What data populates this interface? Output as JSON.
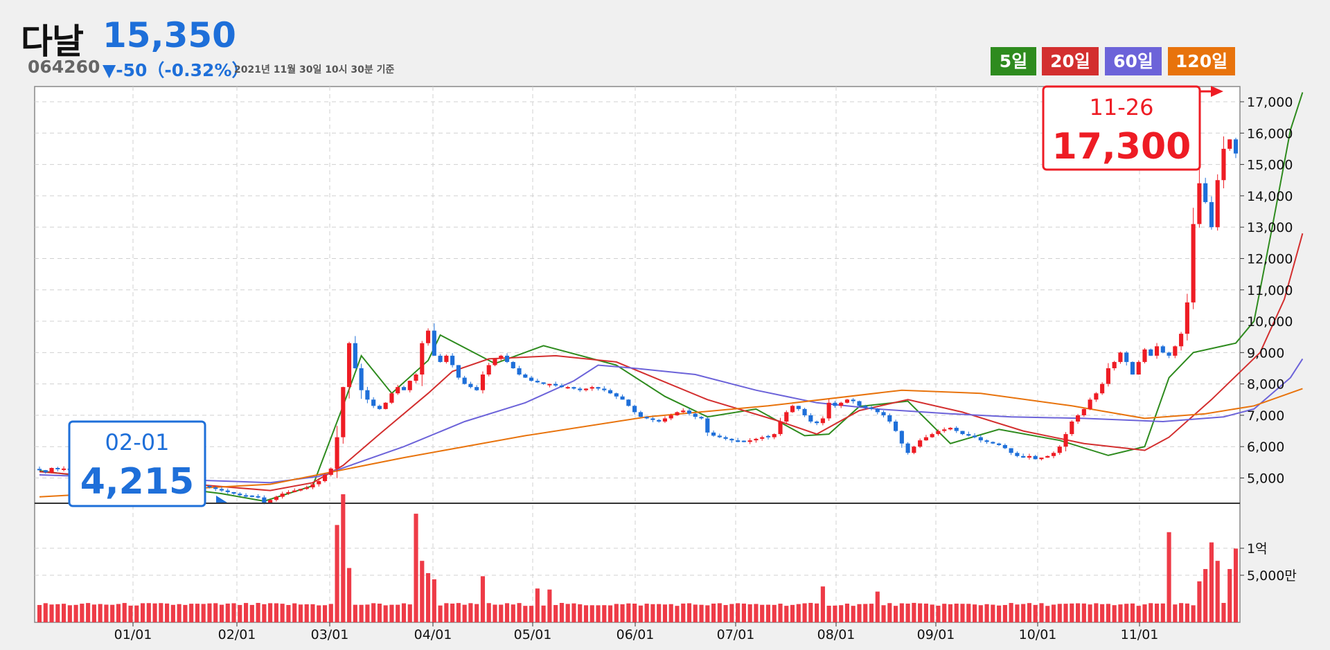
{
  "stock": {
    "name": "다날",
    "price": "15,350",
    "code": "064260",
    "change": "▼-50（-0.32%）",
    "timestamp": "2021년 11월 30일 10시 30분 기준"
  },
  "ma_buttons": [
    {
      "label": "5일",
      "color": "#2e8b1e"
    },
    {
      "label": "20일",
      "color": "#d32f2f"
    },
    {
      "label": "60일",
      "color": "#6c63d9"
    },
    {
      "label": "120일",
      "color": "#e8730c"
    }
  ],
  "colors": {
    "up": "#ee1c24",
    "down": "#1e6fd9",
    "volume": "#ee3b47"
  },
  "callouts": {
    "low": {
      "date": "02-01",
      "value": "4,215",
      "color": "#1e6fd9"
    },
    "high": {
      "date": "11-26",
      "value": "17,300",
      "color": "#ee1c24"
    }
  },
  "chart_data": {
    "type": "candlestick",
    "price_axis": {
      "ticks": [
        5000,
        6000,
        7000,
        8000,
        9000,
        10000,
        11000,
        12000,
        13000,
        14000,
        15000,
        16000,
        17000
      ],
      "labels": [
        "5,000",
        "6,000",
        "7,000",
        "8,000",
        "9,000",
        "10,000",
        "11,000",
        "12,000",
        "13,000",
        "14,000",
        "15,000",
        "16,000",
        "17,000"
      ]
    },
    "volume_axis": {
      "labels": [
        "1억",
        "5,000만"
      ]
    },
    "x_labels": [
      "01/01",
      "02/01",
      "03/01",
      "04/01",
      "05/01",
      "06/01",
      "07/01",
      "08/01",
      "09/01",
      "10/01",
      "11/01"
    ],
    "grid": true,
    "close": [
      5250,
      5180,
      5320,
      5280,
      5300,
      5250,
      5200,
      5150,
      5100,
      5120,
      5080,
      5050,
      5020,
      5000,
      4980,
      4950,
      4930,
      4900,
      4920,
      4880,
      4860,
      4900,
      4870,
      4850,
      4820,
      4800,
      4780,
      4750,
      4700,
      4650,
      4600,
      4550,
      4500,
      4450,
      4420,
      4400,
      4380,
      4215,
      4300,
      4400,
      4500,
      4550,
      4600,
      4650,
      4700,
      4800,
      4900,
      5100,
      5300,
      6300,
      7900,
      9300,
      8500,
      7800,
      7500,
      7300,
      7200,
      7400,
      7700,
      7900,
      7800,
      8100,
      8300,
      9300,
      9700,
      8900,
      8700,
      8900,
      8600,
      8200,
      8000,
      7900,
      7800,
      8300,
      8600,
      8800,
      8900,
      8700,
      8500,
      8300,
      8200,
      8100,
      8050,
      8000,
      8000,
      7950,
      7900,
      7900,
      7850,
      7800,
      7850,
      7900,
      7850,
      7800,
      7700,
      7600,
      7500,
      7300,
      7100,
      6950,
      6900,
      6850,
      6800,
      6900,
      7000,
      7100,
      7150,
      7050,
      6950,
      6900,
      6450,
      6350,
      6300,
      6250,
      6200,
      6150,
      6150,
      6200,
      6250,
      6300,
      6300,
      6400,
      6800,
      7100,
      7300,
      7200,
      7000,
      6800,
      6750,
      6900,
      7400,
      7300,
      7400,
      7500,
      7450,
      7300,
      7250,
      7200,
      7100,
      7000,
      6800,
      6500,
      6100,
      5800,
      6000,
      6200,
      6300,
      6400,
      6500,
      6550,
      6600,
      6500,
      6400,
      6350,
      6300,
      6200,
      6150,
      6100,
      6050,
      5950,
      5800,
      5700,
      5650,
      5700,
      5600,
      5650,
      5700,
      5800,
      6000,
      6400,
      6800,
      7000,
      7200,
      7500,
      7700,
      8000,
      8500,
      8700,
      9000,
      8700,
      8300,
      8700,
      9100,
      8900,
      9200,
      9000,
      8900,
      9200,
      9600,
      10600,
      13100,
      14400,
      13800,
      13000,
      14500,
      15500,
      15800,
      15350
    ],
    "ma": [
      {
        "period": 5,
        "color": "#2e8b1e",
        "points": [
          [
            0,
            5230
          ],
          [
            30,
            4500
          ],
          [
            37,
            4260
          ],
          [
            45,
            4750
          ],
          [
            50,
            7300
          ],
          [
            53,
            8900
          ],
          [
            58,
            7700
          ],
          [
            64,
            8750
          ],
          [
            66,
            9560
          ],
          [
            75,
            8650
          ],
          [
            83,
            9220
          ],
          [
            95,
            8600
          ],
          [
            103,
            7600
          ],
          [
            110,
            6950
          ],
          [
            118,
            7200
          ],
          [
            126,
            6350
          ],
          [
            130,
            6400
          ],
          [
            135,
            7280
          ],
          [
            143,
            7450
          ],
          [
            150,
            6100
          ],
          [
            158,
            6550
          ],
          [
            168,
            6200
          ],
          [
            176,
            5720
          ],
          [
            182,
            6000
          ],
          [
            186,
            8200
          ],
          [
            190,
            9000
          ],
          [
            197,
            9300
          ],
          [
            200,
            10000
          ],
          [
            203,
            13000
          ],
          [
            206,
            16100
          ],
          [
            208,
            17300
          ]
        ]
      },
      {
        "period": 20,
        "color": "#d32f2f",
        "points": [
          [
            0,
            5200
          ],
          [
            38,
            4600
          ],
          [
            45,
            4850
          ],
          [
            50,
            5400
          ],
          [
            56,
            6400
          ],
          [
            64,
            7700
          ],
          [
            68,
            8400
          ],
          [
            74,
            8800
          ],
          [
            85,
            8900
          ],
          [
            95,
            8700
          ],
          [
            110,
            7500
          ],
          [
            122,
            6800
          ],
          [
            128,
            6400
          ],
          [
            135,
            7150
          ],
          [
            143,
            7500
          ],
          [
            152,
            7100
          ],
          [
            162,
            6500
          ],
          [
            172,
            6100
          ],
          [
            182,
            5880
          ],
          [
            186,
            6300
          ],
          [
            193,
            7500
          ],
          [
            201,
            9000
          ],
          [
            205,
            10700
          ],
          [
            208,
            12800
          ]
        ]
      },
      {
        "period": 60,
        "color": "#6c63d9",
        "points": [
          [
            0,
            5100
          ],
          [
            38,
            4850
          ],
          [
            46,
            5050
          ],
          [
            60,
            6000
          ],
          [
            70,
            6800
          ],
          [
            80,
            7400
          ],
          [
            88,
            8100
          ],
          [
            92,
            8600
          ],
          [
            98,
            8500
          ],
          [
            108,
            8300
          ],
          [
            118,
            7800
          ],
          [
            128,
            7400
          ],
          [
            138,
            7200
          ],
          [
            150,
            7050
          ],
          [
            160,
            6950
          ],
          [
            172,
            6900
          ],
          [
            185,
            6800
          ],
          [
            195,
            6950
          ],
          [
            200,
            7200
          ],
          [
            206,
            8200
          ],
          [
            208,
            8800
          ]
        ]
      },
      {
        "period": 120,
        "color": "#e8730c",
        "points": [
          [
            0,
            4400
          ],
          [
            38,
            4800
          ],
          [
            60,
            5650
          ],
          [
            80,
            6350
          ],
          [
            100,
            6950
          ],
          [
            120,
            7300
          ],
          [
            142,
            7800
          ],
          [
            155,
            7700
          ],
          [
            170,
            7300
          ],
          [
            182,
            6900
          ],
          [
            192,
            7050
          ],
          [
            200,
            7300
          ],
          [
            208,
            7850
          ]
        ]
      }
    ],
    "volume_peaks": {
      "49": 95,
      "50": 125,
      "51": 53,
      "62": 106,
      "63": 60,
      "64": 48,
      "65": 42,
      "73": 45,
      "82": 33,
      "84": 32,
      "129": 35,
      "138": 30,
      "186": 88,
      "191": 40,
      "192": 52,
      "193": 78,
      "194": 60,
      "196": 52,
      "197": 72,
      "202": 77,
      "203": 84,
      "204": 86,
      "205": 65,
      "206": 56
    }
  }
}
